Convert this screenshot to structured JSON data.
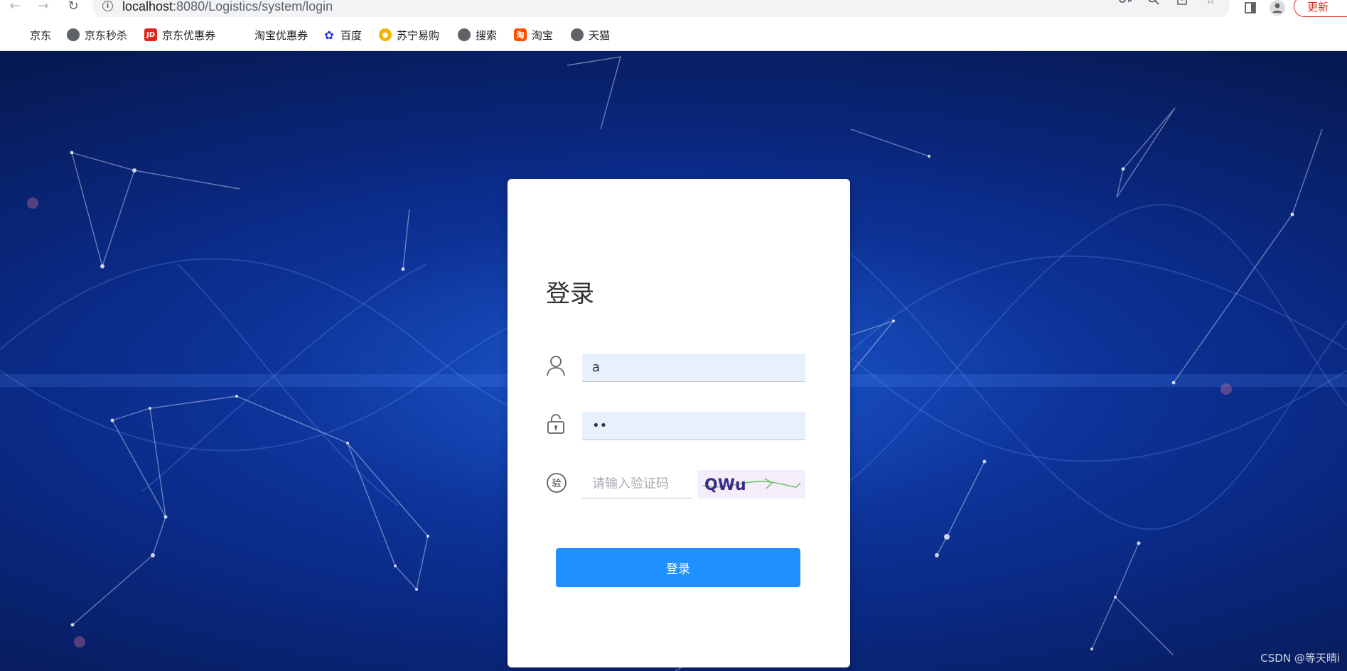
{
  "browser": {
    "url_host": "localhost",
    "url_path": ":8080/Logistics/system/login",
    "update_label": "更新"
  },
  "bookmarks": [
    {
      "label": "京东",
      "icon": "none"
    },
    {
      "label": "京东秒杀",
      "icon": "globe-icon"
    },
    {
      "label": "京东优惠券",
      "icon": "jd-icon"
    },
    {
      "label": "淘宝优惠券",
      "icon": "none"
    },
    {
      "label": "百度",
      "icon": "baidu-icon"
    },
    {
      "label": "苏宁易购",
      "icon": "suning-icon"
    },
    {
      "label": "搜索",
      "icon": "globe-icon"
    },
    {
      "label": "淘宝",
      "icon": "taobao-icon"
    },
    {
      "label": "天猫",
      "icon": "globe-icon"
    }
  ],
  "login": {
    "title": "登录",
    "username_value": "a",
    "password_value": "••",
    "captcha_placeholder": "请输入验证码",
    "captcha_text": "QWu",
    "button_label": "登录"
  },
  "watermark": "CSDN @等天晴i",
  "colors": {
    "primary_button": "#1e90ff",
    "input_autofill_bg": "#e8f0fe",
    "background_dark": "#071a55",
    "background_glow": "#2a6ee6"
  }
}
